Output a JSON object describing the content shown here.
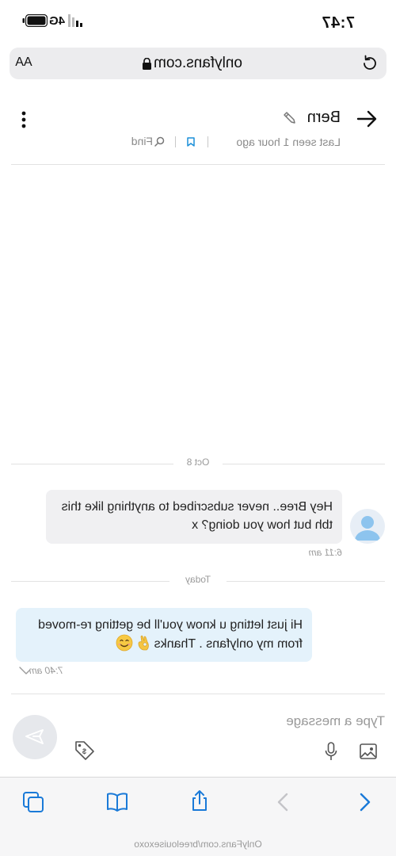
{
  "status_bar": {
    "time": "7:47",
    "network": "4G"
  },
  "browser": {
    "url": "onlyfans.com",
    "text_size_label": "AA",
    "icons": [
      "reload-icon",
      "lock-icon"
    ]
  },
  "chat_header": {
    "contact_name": "Bern",
    "last_seen": "Last seen 1 hour ago",
    "find_label": "Find",
    "icons": [
      "back-arrow-icon",
      "pencil-icon",
      "more-vertical-icon",
      "bookmark-icon",
      "search-icon"
    ]
  },
  "messages": {
    "date_1": "Oct 8",
    "msg_1": {
      "text": "Hey Bree.. never subscribed to anything like this tbh but how you doing? x",
      "time": "6:11 am"
    },
    "date_2": "Today",
    "msg_2": {
      "text": "Hi just letting u know you'll be getting re-moved from my onlyfans . Thanks ",
      "time": "7:40 am"
    }
  },
  "composer": {
    "placeholder": "Type a message",
    "icons": [
      "image-icon",
      "microphone-icon",
      "price-tag-icon",
      "send-icon"
    ]
  },
  "toolbar": {
    "icons": [
      "chevron-left-icon",
      "chevron-right-icon",
      "share-icon",
      "book-icon",
      "tabs-icon"
    ]
  },
  "watermark": "OnlyFans.com/breelouisexoxo",
  "colors": {
    "accent": "#1a8fd8",
    "incoming_bubble": "#f0f0f2",
    "outgoing_bubble": "#e4f2fb",
    "muted_text": "#8a8a8a"
  }
}
